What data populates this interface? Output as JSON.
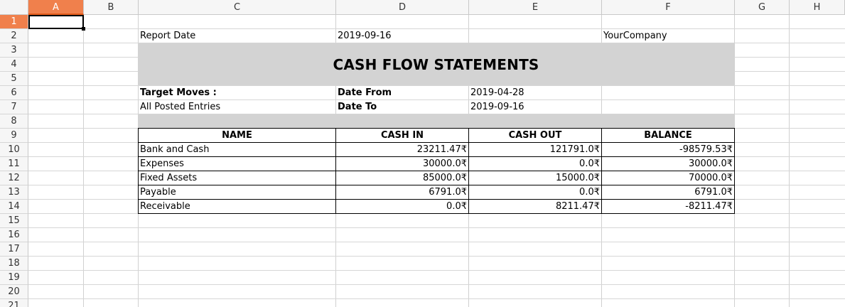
{
  "columns": [
    "A",
    "B",
    "C",
    "D",
    "E",
    "F",
    "G",
    "H"
  ],
  "rows": [
    "1",
    "2",
    "3",
    "4",
    "5",
    "6",
    "7",
    "8",
    "9",
    "10",
    "11",
    "12",
    "13",
    "14",
    "15",
    "16",
    "17",
    "18",
    "19",
    "20",
    "21"
  ],
  "selected_cell": "A1",
  "report": {
    "report_date_label": "Report Date",
    "report_date_value": "2019-09-16",
    "company": "YourCompany",
    "title": "CASH FLOW STATEMENTS",
    "target_moves_label": "Target Moves :",
    "target_moves_value": "All Posted Entries",
    "date_from_label": "Date From",
    "date_from_value": "2019-04-28",
    "date_to_label": "Date To",
    "date_to_value": "2019-09-16"
  },
  "table": {
    "headers": [
      "NAME",
      "CASH IN",
      "CASH OUT",
      "BALANCE"
    ],
    "rows": [
      [
        "Bank and Cash",
        "23211.47₹",
        "121791.0₹",
        "-98579.53₹"
      ],
      [
        "Expenses",
        "30000.0₹",
        "0.0₹",
        "30000.0₹"
      ],
      [
        "Fixed Assets",
        "85000.0₹",
        "15000.0₹",
        "70000.0₹"
      ],
      [
        "Payable",
        "6791.0₹",
        "0.0₹",
        "6791.0₹"
      ],
      [
        "Receivable",
        "0.0₹",
        "8211.47₹",
        "-8211.47₹"
      ]
    ]
  },
  "colors": {
    "selected_header": "#f0804c",
    "title_band": "#d3d3d3",
    "grid_line": "#d0d0d0"
  }
}
